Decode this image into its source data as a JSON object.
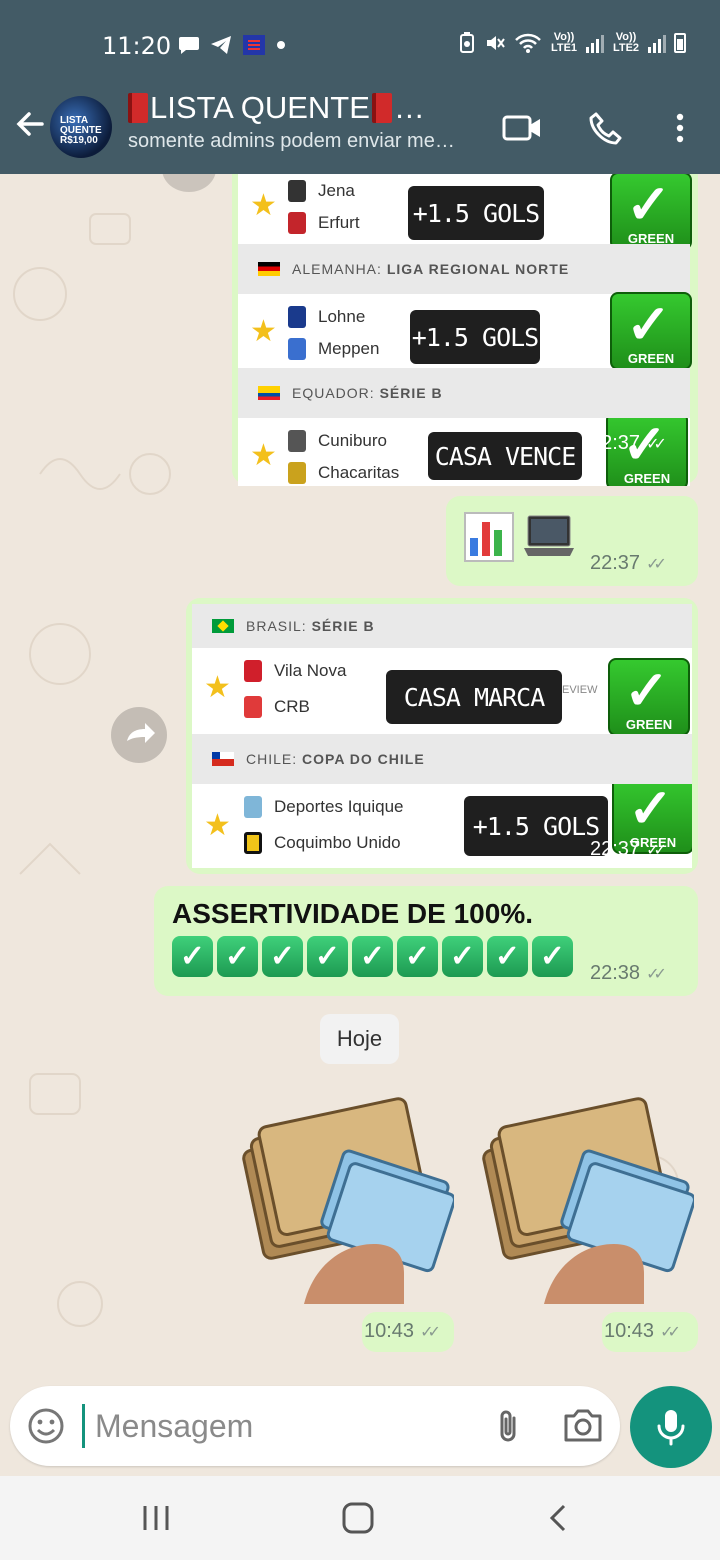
{
  "status": {
    "time": "11:20",
    "lte1": "Vo)) LTE1",
    "lte2": "Vo)) LTE2"
  },
  "header": {
    "title": "LISTA QUENTE",
    "subtitle": "somente admins podem enviar me…",
    "avatar_text": "LISTA QUENTE R$19,00"
  },
  "messages": {
    "card1": {
      "matches": [
        {
          "team_home": "Jena",
          "team_away": "Erfurt",
          "tip": "+1.5 GOLS",
          "result": "GREEN"
        },
        {
          "team_home": "Lohne",
          "team_away": "Meppen",
          "tip": "+1.5 GOLS",
          "result": "GREEN"
        },
        {
          "team_home": "Cuniburo",
          "team_away": "Chacaritas",
          "tip": "CASA VENCE",
          "result": "GREEN"
        }
      ],
      "leagues": [
        {
          "country": "ALEMANHA:",
          "name": "LIGA REGIONAL NORTE"
        },
        {
          "country": "EQUADOR:",
          "name": "SÉRIE B"
        }
      ],
      "time": "22:37"
    },
    "emoji_msg": {
      "time": "22:37"
    },
    "card2": {
      "leagues": [
        {
          "country": "BRASIL:",
          "name": "SÉRIE B"
        },
        {
          "country": "CHILE:",
          "name": "COPA DO CHILE"
        }
      ],
      "matches": [
        {
          "team_home": "Vila Nova",
          "team_away": "CRB",
          "tip": "CASA MARCA",
          "result": "GREEN",
          "partial": "EVIEW"
        },
        {
          "team_home": "Deportes Iquique",
          "team_away": "Coquimbo Unido",
          "tip": "+1.5 GOLS",
          "result": "GREEN"
        }
      ],
      "time": "22:37"
    },
    "text_msg": {
      "text": "ASSERTIVIDADE DE 100%.",
      "checks": 9,
      "time": "22:38"
    },
    "day_separator": "Hoje",
    "stickers": [
      {
        "time": "10:43"
      },
      {
        "time": "10:43"
      }
    ]
  },
  "composer": {
    "placeholder": "Mensagem"
  },
  "colors": {
    "header": "#435b66",
    "bubble_out": "#dcf8c6",
    "accent": "#14937d",
    "green_badge": "#2fb827"
  }
}
